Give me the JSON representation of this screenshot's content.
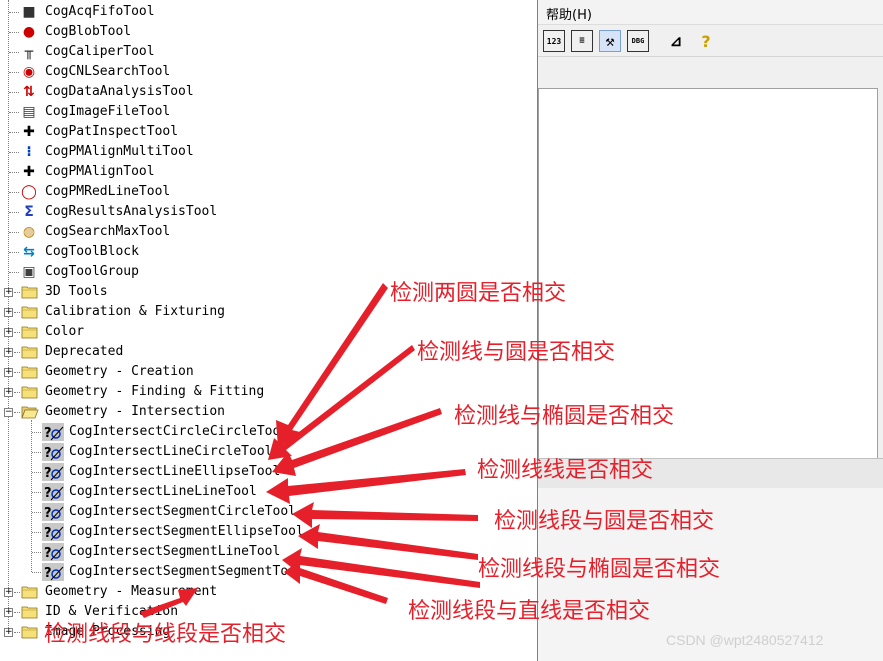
{
  "menu": {
    "help": "帮助(H)"
  },
  "toolbar": {
    "buttons": [
      "123",
      "≡",
      "⚒",
      "DBG",
      "⊿",
      "?"
    ]
  },
  "tree": {
    "tools": [
      "CogAcqFifoTool",
      "CogBlobTool",
      "CogCaliperTool",
      "CogCNLSearchTool",
      "CogDataAnalysisTool",
      "CogImageFileTool",
      "CogPatInspectTool",
      "CogPMAlignMultiTool",
      "CogPMAlignTool",
      "CogPMRedLineTool",
      "CogResultsAnalysisTool",
      "CogSearchMaxTool",
      "CogToolBlock",
      "CogToolGroup"
    ],
    "folders": [
      "3D Tools",
      "Calibration & Fixturing",
      "Color",
      "Deprecated",
      "Geometry - Creation",
      "Geometry - Finding & Fitting",
      "Geometry - Intersection"
    ],
    "intersection_tools": [
      "CogIntersectCircleCircleTool",
      "CogIntersectLineCircleTool",
      "CogIntersectLineEllipseTool",
      "CogIntersectLineLineTool",
      "CogIntersectSegmentCircleTool",
      "CogIntersectSegmentEllipseTool",
      "CogIntersectSegmentLineTool",
      "CogIntersectSegmentSegmentTool"
    ],
    "bottom_folders": [
      "Geometry - Measurement",
      "ID & Verification",
      "Image Processing"
    ]
  },
  "annotations": {
    "circle_circle": "检测两圆是否相交",
    "line_circle": "检测线与圆是否相交",
    "line_ellipse": "检测线与椭圆是否相交",
    "line_line": "检测线线是否相交",
    "segment_circle": "检测线段与圆是否相交",
    "segment_ellipse": "检测线段与椭圆是否相交",
    "segment_line": "检测线段与直线是否相交",
    "segment_segment": "检测线段与线段是否相交",
    "color": "#e5202a"
  },
  "watermark": "CSDN @wpt2480527412"
}
